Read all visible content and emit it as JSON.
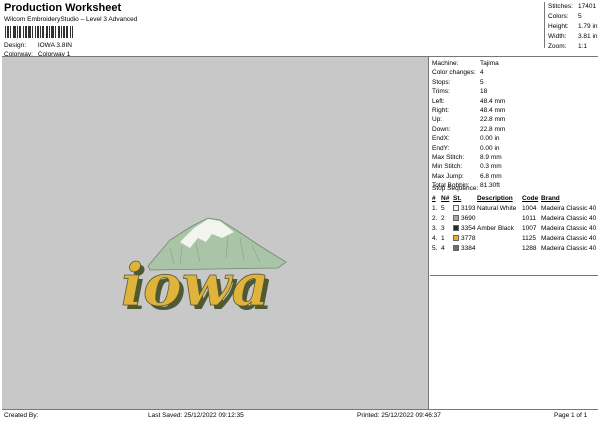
{
  "header": {
    "title": "Production Worksheet",
    "subtitle": "Wilcom EmbroideryStudio – Level 3 Advanced",
    "barcode_digit": "1",
    "design_label": "Design:",
    "design_value": "IOWA 3.8IN",
    "colorway_label": "Colorway:",
    "colorway_value": "Colorway 1"
  },
  "summary": [
    {
      "label": "Stitches:",
      "value": "17401"
    },
    {
      "label": "Colors:",
      "value": "5"
    },
    {
      "label": "Height:",
      "value": "1.79 in"
    },
    {
      "label": "Width:",
      "value": "3.81 in"
    },
    {
      "label": "Zoom:",
      "value": "1:1"
    }
  ],
  "info": [
    {
      "label": "Machine:",
      "value": "Tajima"
    },
    {
      "label": "Color changes:",
      "value": "4"
    },
    {
      "label": "Stops:",
      "value": "5"
    },
    {
      "label": "Trims:",
      "value": "18"
    },
    {
      "label": "Left:",
      "value": "48.4 mm"
    },
    {
      "label": "Right:",
      "value": "48.4 mm"
    },
    {
      "label": "Up:",
      "value": "22.8 mm"
    },
    {
      "label": "Down:",
      "value": "22.8 mm"
    },
    {
      "label": "EndX:",
      "value": "0.00 in"
    },
    {
      "label": "EndY:",
      "value": "0.00 in"
    },
    {
      "label": "Max Stitch:",
      "value": "8.9 mm"
    },
    {
      "label": "Min Stitch:",
      "value": "0.3 mm"
    },
    {
      "label": "Max Jump:",
      "value": "6.8 mm"
    },
    {
      "label": "Total Bobbin:",
      "value": "81.30ft"
    }
  ],
  "stop_sequence": {
    "heading": "Stop Sequence:",
    "columns": [
      "#",
      "N#",
      "St.",
      "Description",
      "Code",
      "Brand"
    ],
    "rows": [
      {
        "num": "1.",
        "n": "5",
        "st": "3193",
        "desc": "Natural White",
        "code": "1004",
        "brand": "Madeira Classic 40",
        "color": "#f4f4f0"
      },
      {
        "num": "2.",
        "n": "2",
        "st": "3690",
        "desc": "",
        "code": "1011",
        "brand": "Madeira Classic 40",
        "color": "#a8a8a8"
      },
      {
        "num": "3.",
        "n": "3",
        "st": "3354",
        "desc": "Amber Black",
        "code": "1007",
        "brand": "Madeira Classic 40",
        "color": "#2a2a2a"
      },
      {
        "num": "4.",
        "n": "1",
        "st": "3778",
        "desc": "",
        "code": "1125",
        "brand": "Madeira Classic 40",
        "color": "#e6b331"
      },
      {
        "num": "5.",
        "n": "4",
        "st": "3384",
        "desc": "",
        "code": "1288",
        "brand": "Madeira Classic 40",
        "color": "#6e6e6e"
      }
    ]
  },
  "footer": {
    "created_by": "Created By:",
    "last_saved": "Last Saved: 25/12/2022 09:12:35",
    "printed": "Printed: 25/12/2022 09:46:37",
    "page": "Page 1 of 1"
  },
  "colors": {
    "canvas_bg": "#c8c8c8",
    "lettering_fill": "#e0b43a",
    "lettering_shadow": "#4e5a32",
    "mountain_green": "#a9c4a6",
    "mountain_snow": "#f2f4ee"
  }
}
